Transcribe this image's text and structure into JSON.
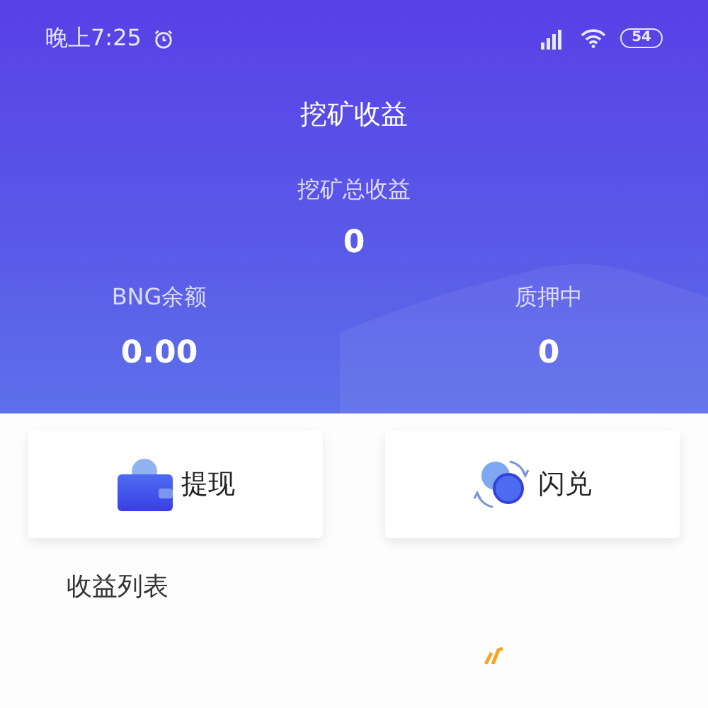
{
  "status_bar": {
    "time": "晚上7:25",
    "battery": "54"
  },
  "header": {
    "title": "挖矿收益"
  },
  "total": {
    "label": "挖矿总收益",
    "value": "0"
  },
  "stats": [
    {
      "label": "BNG余额",
      "value": "0.00"
    },
    {
      "label": "质押中",
      "value": "0"
    }
  ],
  "actions": [
    {
      "kind": "withdraw",
      "label": "提现"
    },
    {
      "kind": "swap",
      "label": "闪兑"
    }
  ],
  "list": {
    "title": "收益列表"
  }
}
